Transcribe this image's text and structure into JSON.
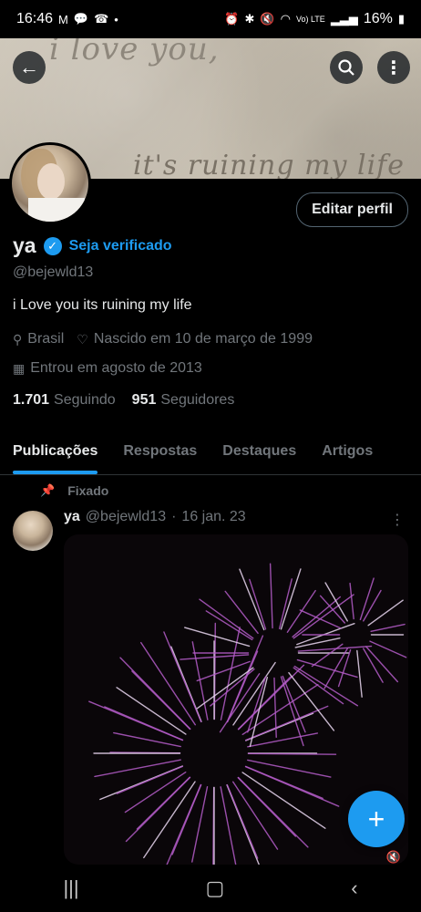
{
  "status_bar": {
    "time": "16:46",
    "notification_icons": [
      "gmail-icon",
      "message-icon",
      "missed-call-icon",
      "dot-icon"
    ],
    "network_label": "Vo) LTE",
    "battery": "16%"
  },
  "banner": {
    "text_line_1": "i love you,",
    "text_line_2": "it's ruining my life"
  },
  "profile": {
    "name": "ya",
    "verify_label": "Seja verificado",
    "handle": "@bejewld13",
    "bio": "i Love you its ruining my life",
    "location": "Brasil",
    "birth": "Nascido em 10 de março de 1999",
    "joined": "Entrou em agosto de 2013",
    "following_count": "1.701",
    "following_label": "Seguindo",
    "followers_count": "951",
    "followers_label": "Seguidores",
    "edit_button": "Editar perfil"
  },
  "tabs": [
    {
      "label": "Publicações",
      "active": true
    },
    {
      "label": "Respostas",
      "active": false
    },
    {
      "label": "Destaques",
      "active": false
    },
    {
      "label": "Artigos",
      "active": false
    }
  ],
  "pinned_post": {
    "pinned_label": "Fixado",
    "author": "ya",
    "handle": "@bejewld13",
    "separator": "·",
    "date": "16 jan. 23"
  },
  "colors": {
    "accent": "#1d9bf0",
    "background": "#000000",
    "secondary_text": "#71767b",
    "firework": "#b45cc8"
  }
}
